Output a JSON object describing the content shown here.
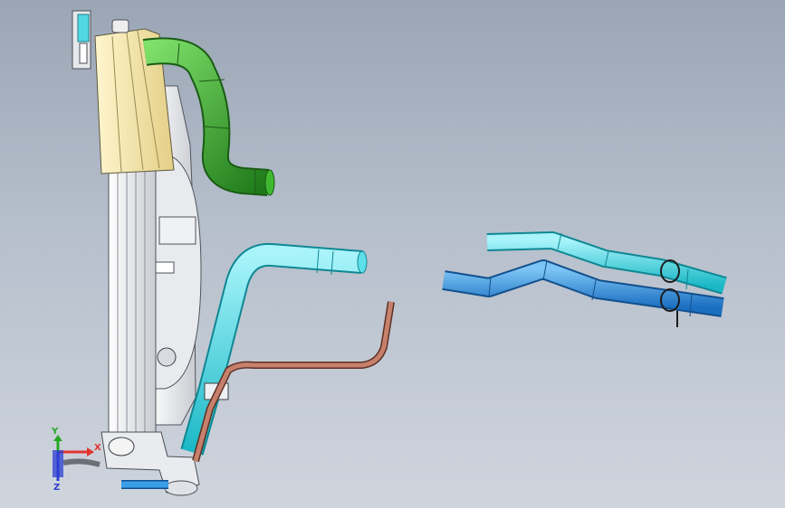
{
  "viewport": {
    "background_top": "#9aa6b5",
    "background_bottom": "#cfd5dd"
  },
  "colors": {
    "upper_hose": "#2f9a25",
    "cyan_hose": "#37d3df",
    "blue_hose": "#2591de",
    "copper_pipe": "#b07260",
    "radiator_tank": "#f2e3a8",
    "radiator_frame": "#f4f5f7"
  },
  "triad": {
    "x_label": "X",
    "y_label": "Y",
    "z_label": "Z",
    "x_color": "#e3342f",
    "y_color": "#25a825",
    "z_color": "#2c3ed1"
  }
}
